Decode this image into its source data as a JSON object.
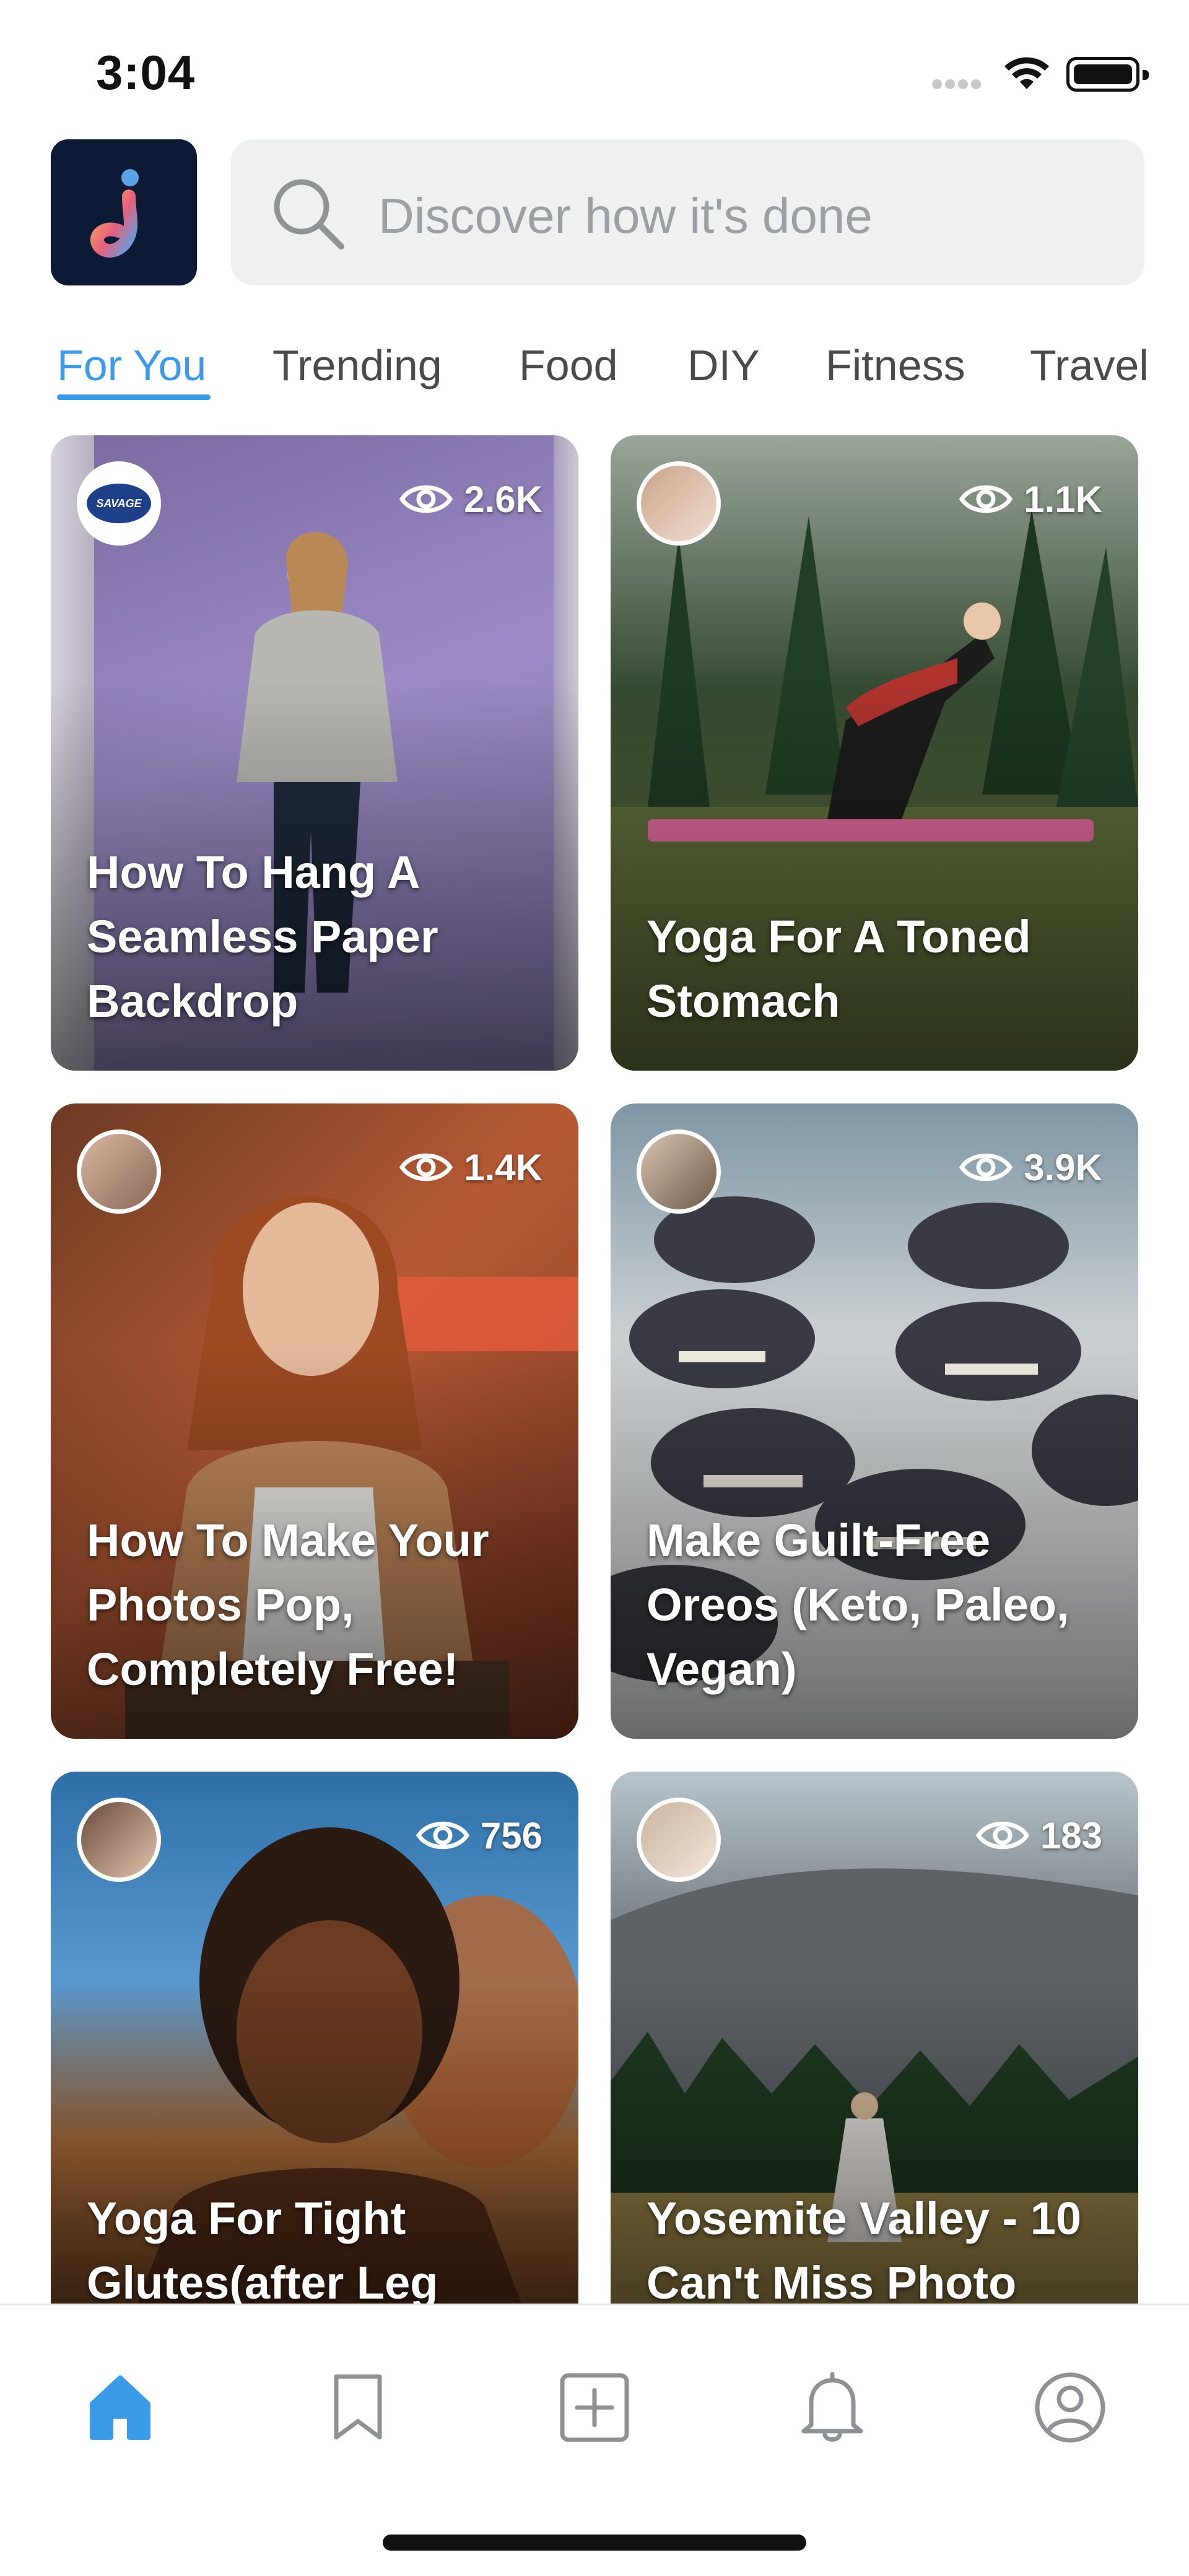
{
  "status_bar": {
    "time": "3:04"
  },
  "search": {
    "placeholder": "Discover how it's done"
  },
  "tabs": [
    {
      "label": "For You",
      "active": true
    },
    {
      "label": "Trending",
      "active": false
    },
    {
      "label": "Food",
      "active": false
    },
    {
      "label": "DIY",
      "active": false
    },
    {
      "label": "Fitness",
      "active": false
    },
    {
      "label": "Travel",
      "active": false
    }
  ],
  "cards": [
    {
      "views": "2.6K",
      "title": "How To Hang A Seamless Paper Backdrop",
      "avatar_text": "SAVAGE"
    },
    {
      "views": "1.1K",
      "title": "Yoga For A Toned Stomach"
    },
    {
      "views": "1.4K",
      "title": "How To Make Your Photos Pop, Completely Free!"
    },
    {
      "views": "3.9K",
      "title": "Make Guilt-Free Oreos (Keto, Paleo, Vegan)"
    },
    {
      "views": "756",
      "title": "Yoga For Tight Glutes(after Leg"
    },
    {
      "views": "183",
      "title": "Yosemite Valley - 10 Can't Miss Photo"
    }
  ],
  "bottom_nav": [
    "home-icon",
    "bookmark-icon",
    "add-icon",
    "bell-icon",
    "profile-icon"
  ],
  "colors": {
    "accent": "#3b9be8",
    "logo_bg": "#0c1a35"
  }
}
